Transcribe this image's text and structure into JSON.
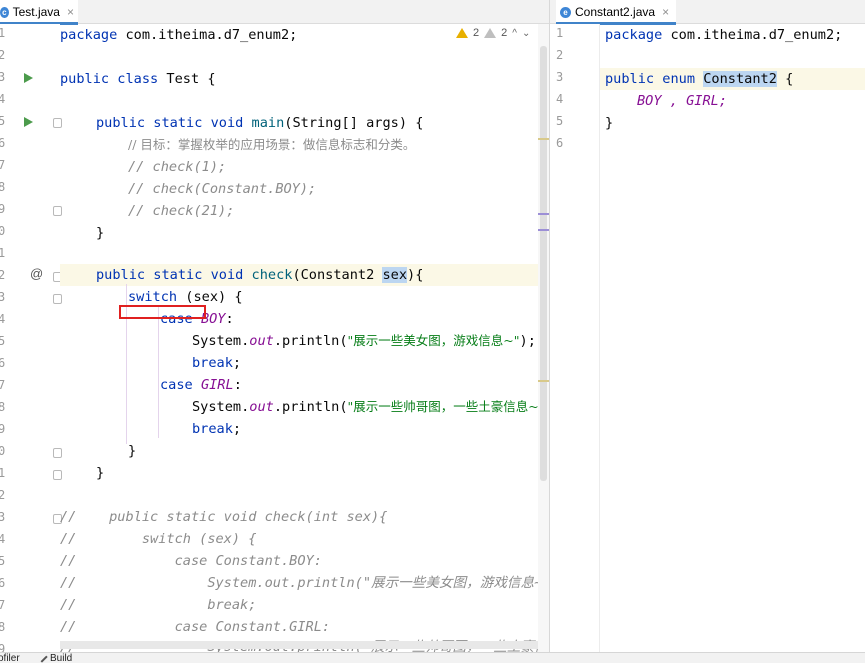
{
  "tabs": {
    "left": {
      "label": "Test.java",
      "icon": "java-class-icon",
      "close": "×"
    },
    "right": {
      "label": "Constant2.java",
      "icon": "java-class-icon",
      "close": "×"
    }
  },
  "inspections": {
    "warnings": "2",
    "weak_warnings": "2",
    "up": "^",
    "down": "⌄"
  },
  "left_line_numbers": [
    "1",
    "2",
    "3",
    "4",
    "5",
    "6",
    "7",
    "8",
    "9",
    "0",
    "1",
    "2",
    "3",
    "4",
    "5",
    "6",
    "7",
    "8",
    "9",
    "0",
    "1",
    "2",
    "3",
    "4",
    "5",
    "6",
    "7",
    "8",
    "9"
  ],
  "right_line_numbers": [
    "1",
    "2",
    "3",
    "4",
    "5",
    "6"
  ],
  "left_code": {
    "l1_kw": "package",
    "l1_rest": " com.itheima.d7_enum2;",
    "l3_kw": "public class",
    "l3_rest": " Test {",
    "l5_kw": "public static void",
    "l5_fn": "main",
    "l5_rest": "(String[] args) {",
    "l6": "// 目标：掌握枚举的应用场景：做信息标志和分类。",
    "l7": "// check(1);",
    "l8": "// check(Constant.BOY);",
    "l9": "// check(21);",
    "l10": "}",
    "l12_kw": "public static void",
    "l12_fn": "check",
    "l12_a": "(Constant2 ",
    "l12_sel": "sex",
    "l12_b": "){",
    "l13_kw": "switch",
    "l13_rest": " (sex) {",
    "l14_kw": "case",
    "l14_en": "BOY",
    "l14_rest": ":",
    "l15_a": "System.",
    "l15_out": "out",
    "l15_b": ".println(",
    "l15_str": "\"展示一些美女图，游戏信息~\"",
    "l15_c": ");",
    "l16_kw": "break",
    "l16_rest": ";",
    "l17_kw": "case",
    "l17_en": "GIRL",
    "l17_rest": ":",
    "l18_a": "System.",
    "l18_out": "out",
    "l18_b": ".println(",
    "l18_str": "\"展示一些帅哥图，一些土豪信息~\"",
    "l19_kw": "break",
    "l19_rest": ";",
    "l20": "}",
    "l21": "}",
    "l23": "//    public static void check(int sex){",
    "l24": "//        switch (sex) {",
    "l25": "//            case Constant.BOY:",
    "l26": "//                System.out.println(\"展示一些美女图，游戏信息~\")",
    "l27": "//                break;",
    "l28": "//            case Constant.GIRL:",
    "l29": "//                System.out.println(\"展示一些帅哥图，一些土豪信息"
  },
  "right_code": {
    "l1_kw": "package",
    "l1_rest": " com.itheima.d7_enum2;",
    "l3_kw": "public enum",
    "l3_name": "Constant2",
    "l3_rest": " {",
    "l4": "BOY , GIRL;",
    "l5": "}"
  },
  "statusbar": {
    "profiler": "ofiler",
    "build": "Build"
  }
}
